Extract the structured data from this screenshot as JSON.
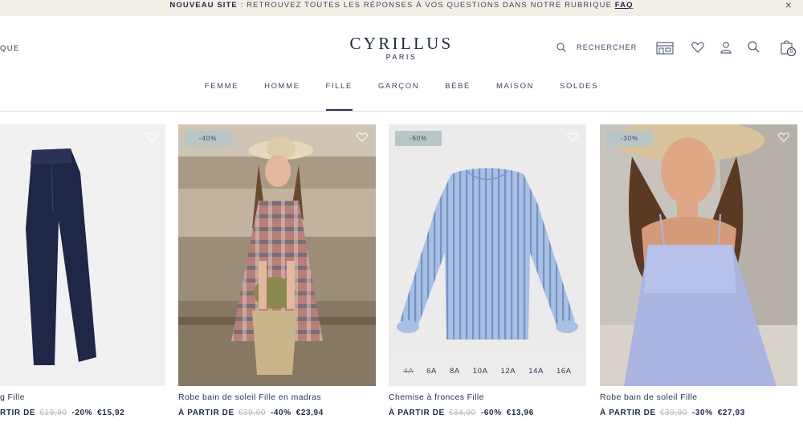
{
  "announcement": {
    "bold": "NOUVEAU SITE",
    "text": " : RETROUVEZ TOUTES LES RÉPONSES À VOS QUESTIONS DANS NOTRE RUBRIQUE ",
    "link": "FAQ",
    "close": "×"
  },
  "header": {
    "left_link": "QUE",
    "brand": "CYRILLUS",
    "city": "PARIS",
    "search_label": "RECHERCHER",
    "bag_count": "0"
  },
  "nav": [
    "FEMME",
    "HOMME",
    "FILLE",
    "GARÇON",
    "BÉBÉ",
    "MAISON",
    "SOLDES"
  ],
  "nav_active": "FILLE",
  "products": [
    {
      "badge": "",
      "name": "g Fille",
      "price_prefix": "RTIR DE",
      "old_price": "€19,90",
      "discount": "-20%",
      "price": "€15,92"
    },
    {
      "badge": "-40%",
      "name": "Robe bain de soleil Fille en madras",
      "price_prefix": "À PARTIR DE",
      "old_price": "€39,90",
      "discount": "-40%",
      "price": "€23,94"
    },
    {
      "badge": "-60%",
      "name": "Chemise à fronces Fille",
      "price_prefix": "À PARTIR DE",
      "old_price": "€34,90",
      "discount": "-60%",
      "price": "€13,96",
      "sizes": [
        "4A",
        "6A",
        "8A",
        "10A",
        "12A",
        "14A",
        "16A"
      ]
    },
    {
      "badge": "-30%",
      "name": "Robe bain de soleil Fille",
      "price_prefix": "À PARTIR DE",
      "old_price": "€39,90",
      "discount": "-30%",
      "price": "€27,93"
    }
  ],
  "colors": {
    "navy": "#1d2a44",
    "announce_bg": "#f4efe6",
    "badge_bg": "#b9c6c7"
  },
  "icons": [
    "close-icon",
    "search-icon",
    "store-icon",
    "heart-icon",
    "user-icon",
    "bag-icon"
  ]
}
